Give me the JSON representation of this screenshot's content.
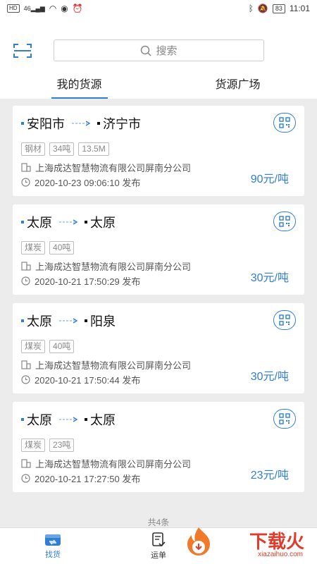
{
  "status_bar": {
    "left_badge": "HD",
    "signal": "46",
    "battery": "83",
    "time": "11:01"
  },
  "search": {
    "placeholder": "搜索"
  },
  "tabs": [
    {
      "label": "我的货源"
    },
    {
      "label": "货源广场"
    }
  ],
  "cards": [
    {
      "from": "安阳市",
      "to": "济宁市",
      "tags": [
        "钢材",
        "34吨",
        "13.5M"
      ],
      "company": "上海成达智慧物流有限公司屏南分公司",
      "time": "2020-10-23 09:06:10 发布",
      "price": "90元/吨"
    },
    {
      "from": "太原",
      "to": "太原",
      "tags": [
        "煤炭",
        "40吨"
      ],
      "company": "上海成达智慧物流有限公司屏南分公司",
      "time": "2020-10-21 17:50:29 发布",
      "price": "30元/吨"
    },
    {
      "from": "太原",
      "to": "阳泉",
      "tags": [
        "煤炭",
        "40吨"
      ],
      "company": "上海成达智慧物流有限公司屏南分公司",
      "time": "2020-10-21 17:50:44 发布",
      "price": "30元/吨"
    },
    {
      "from": "太原",
      "to": "太原",
      "tags": [
        "煤炭",
        "23吨"
      ],
      "company": "上海成达智慧物流有限公司屏南分公司",
      "time": "2020-10-21 17:27:50 发布",
      "price": "23元/吨"
    }
  ],
  "total": "共4条",
  "bottom_nav": [
    {
      "label": "找货",
      "icon": "truck-box-icon"
    },
    {
      "label": "运单",
      "icon": "waybill-icon"
    }
  ],
  "watermark": {
    "text": "下载火",
    "sub": "xiazaihuo.com"
  },
  "colors": {
    "accent": "#2f7fd6",
    "background": "#ececec",
    "watermark": "#e03b2b"
  }
}
